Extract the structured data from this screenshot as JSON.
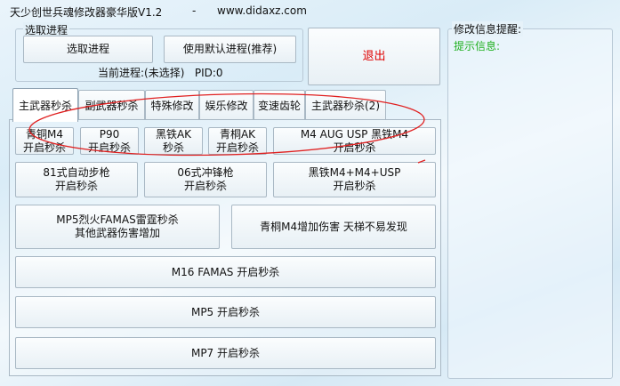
{
  "window": {
    "title": "天少创世兵魂修改器豪华版V1.2",
    "dash": "-",
    "url": "www.didaxz.com"
  },
  "process": {
    "group_label": "选取进程",
    "select_button": "选取进程",
    "default_button": "使用默认进程(推荐)",
    "status": "当前进程:(未选择)   PID:0"
  },
  "exit_button": "退出",
  "info": {
    "group_label": "修改信息提醒:",
    "prompt": "提示信息:"
  },
  "tabs": [
    "主武器秒杀",
    "副武器秒杀",
    "特殊修改",
    "娱乐修改",
    "变速齿轮",
    "主武器秒杀(2)"
  ],
  "buttons": {
    "b1": [
      "青铜M4",
      "开启秒杀"
    ],
    "b2": [
      "P90",
      "开启秒杀"
    ],
    "b3": [
      "黑铁AK",
      "秒杀"
    ],
    "b4": [
      "青桐AK",
      "开启秒杀"
    ],
    "b5": [
      "M4 AUG USP 黑铁M4",
      "开启秒杀"
    ],
    "b6": [
      "81式自动步枪",
      "开启秒杀"
    ],
    "b7": [
      "06式冲锋枪",
      "开启秒杀"
    ],
    "b8": [
      "黑铁M4+M4+USP",
      "开启秒杀"
    ],
    "b9": [
      "MP5烈火FAMAS雷霆秒杀",
      "其他武器伤害增加"
    ],
    "b10": "青桐M4增加伤害 天梯不易发现",
    "b11": "M16 FAMAS 开启秒杀",
    "b12": "MP5 开启秒杀",
    "b13": "MP7 开启秒杀"
  },
  "colors": {
    "exit_text": "#e00000",
    "prompt_text": "#20b020",
    "annotation": "#e02020"
  }
}
